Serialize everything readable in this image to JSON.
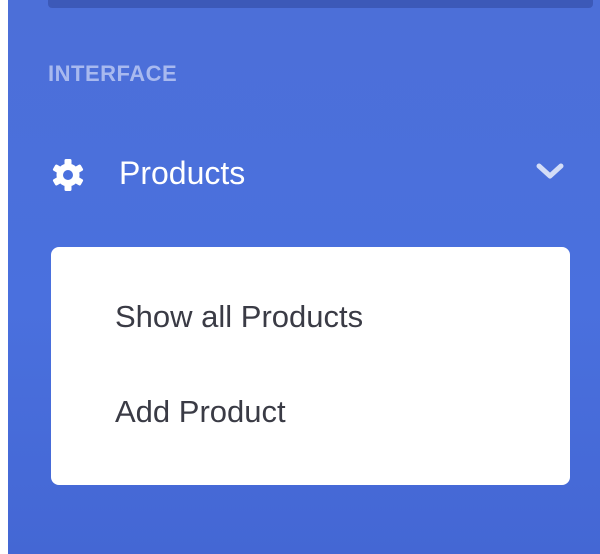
{
  "sidebar": {
    "heading": "INTERFACE",
    "nav_item": {
      "label": "Products",
      "icon": "gear-icon",
      "toggle_icon": "chevron-down-icon",
      "expanded": true
    },
    "submenu": {
      "items": [
        {
          "label": "Show all Products"
        },
        {
          "label": "Add Product"
        }
      ]
    }
  },
  "colors": {
    "sidebar_bg": "#4a70de",
    "heading": "#a8b9ef",
    "nav_text": "#ffffff",
    "submenu_bg": "#ffffff",
    "submenu_text": "#3a3b45"
  }
}
